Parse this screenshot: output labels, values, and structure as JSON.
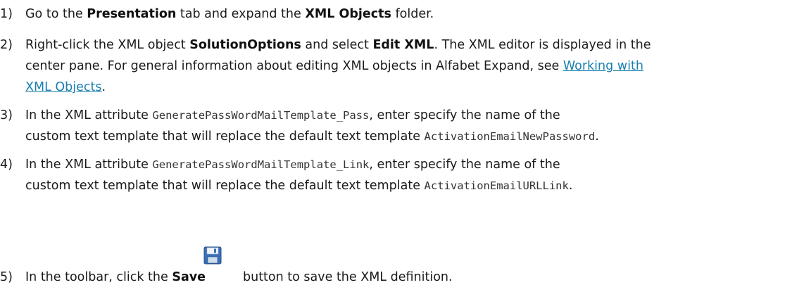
{
  "steps": [
    {
      "number": "1)",
      "text_1": "Go to the ",
      "bold_1": "Presentation",
      "text_2": " tab and expand the ",
      "bold_2": "XML Objects",
      "text_3": " folder."
    },
    {
      "number": "2)",
      "text_1": "Right-click the XML object ",
      "bold_1": "SolutionOptions",
      "text_2": " and select ",
      "bold_2": "Edit XML",
      "text_3": ". The XML editor is displayed in the",
      "line2_text": "center pane. For general information about editing XML objects in Alfabet Expand, see ",
      "link_part1": "Working with ",
      "link_part2": "XML Objects",
      "line3_text": "."
    },
    {
      "number": "3)",
      "text_1": "In the XML attribute ",
      "code_1": "GeneratePassWordMailTemplate_Pass",
      "text_2": ", enter specify the name of the",
      "line2_text": "custom text template that will replace the default text template ",
      "code_2": "ActivationEmailNewPassword",
      "line2_end": "."
    },
    {
      "number": "4)",
      "text_1": "In the XML attribute ",
      "code_1": "GeneratePassWordMailTemplate_Link",
      "text_2": ", enter specify the name of the",
      "line2_text": "custom text template that will replace the default text template ",
      "code_2": "ActivationEmailURLLink",
      "line2_end": "."
    },
    {
      "number": "5)",
      "text_1": "In the toolbar, click the ",
      "bold_1": "Save",
      "icon": "save-floppy-icon",
      "text_2": "button to save the XML definition."
    }
  ],
  "colors": {
    "link": "#1a7fb0",
    "text": "#1a1a1a"
  }
}
